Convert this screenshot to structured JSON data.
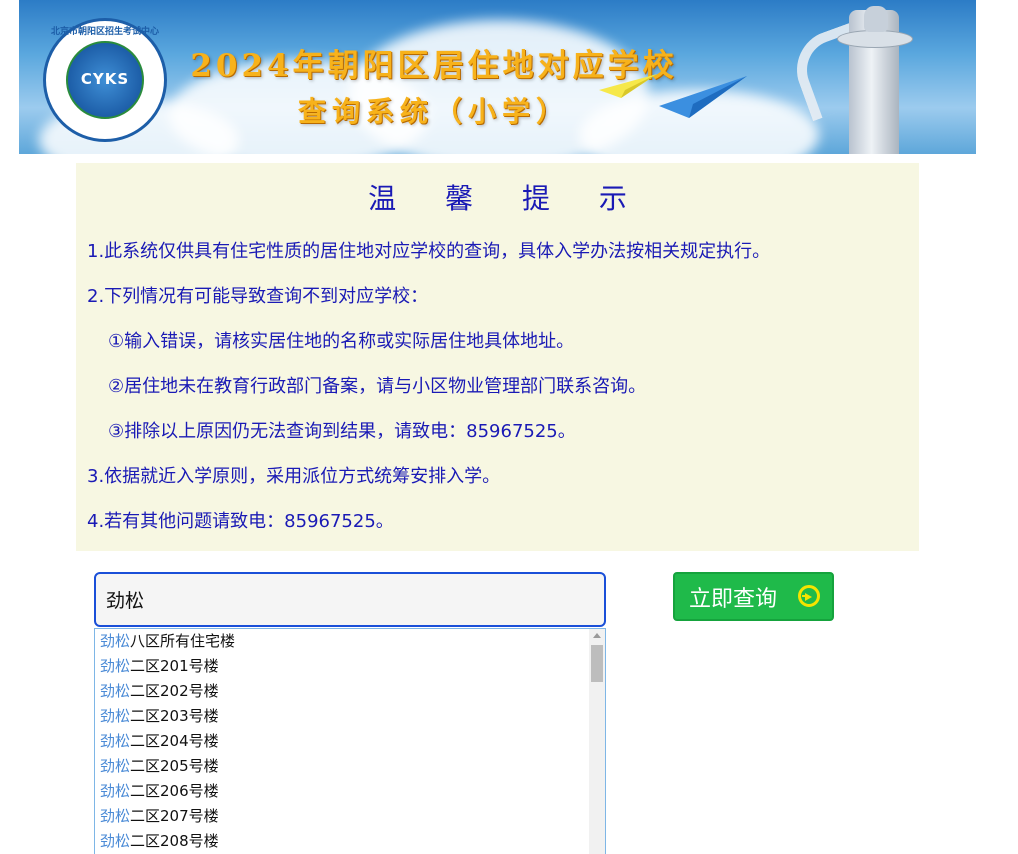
{
  "banner": {
    "logo_text": "CYKS",
    "logo_arc_text": "北京市朝阳区招生考试中心",
    "title_line1": "2024年朝阳区居住地对应学校",
    "title_line2": "查询系统（小学）"
  },
  "notice": {
    "title": "温 馨 提 示",
    "lines": [
      "1.此系统仅供具有住宅性质的居住地对应学校的查询，具体入学办法按相关规定执行。",
      "2.下列情况有可能导致查询不到对应学校：",
      "①输入错误，请核实居住地的名称或实际居住地具体地址。",
      "②居住地未在教育行政部门备案，请与小区物业管理部门联系咨询。",
      "③排除以上原因仍无法查询到结果，请致电：85967525。",
      "3.依据就近入学原则，采用派位方式统筹安排入学。",
      "4.若有其他问题请致电：85967525。"
    ]
  },
  "search": {
    "value": "劲松",
    "button_label": "立即查询",
    "button_icon": "arrow-circle-right-icon",
    "suggestions": [
      {
        "match": "劲松",
        "rest": "八区所有住宅楼"
      },
      {
        "match": "劲松",
        "rest": "二区201号楼"
      },
      {
        "match": "劲松",
        "rest": "二区202号楼"
      },
      {
        "match": "劲松",
        "rest": "二区203号楼"
      },
      {
        "match": "劲松",
        "rest": "二区204号楼"
      },
      {
        "match": "劲松",
        "rest": "二区205号楼"
      },
      {
        "match": "劲松",
        "rest": "二区206号楼"
      },
      {
        "match": "劲松",
        "rest": "二区207号楼"
      },
      {
        "match": "劲松",
        "rest": "二区208号楼"
      }
    ]
  },
  "colors": {
    "notice_text": "#1a1ab5",
    "notice_bg": "#f7f7e2",
    "button_bg": "#1fba4a",
    "match_highlight": "#4a8ad6"
  }
}
